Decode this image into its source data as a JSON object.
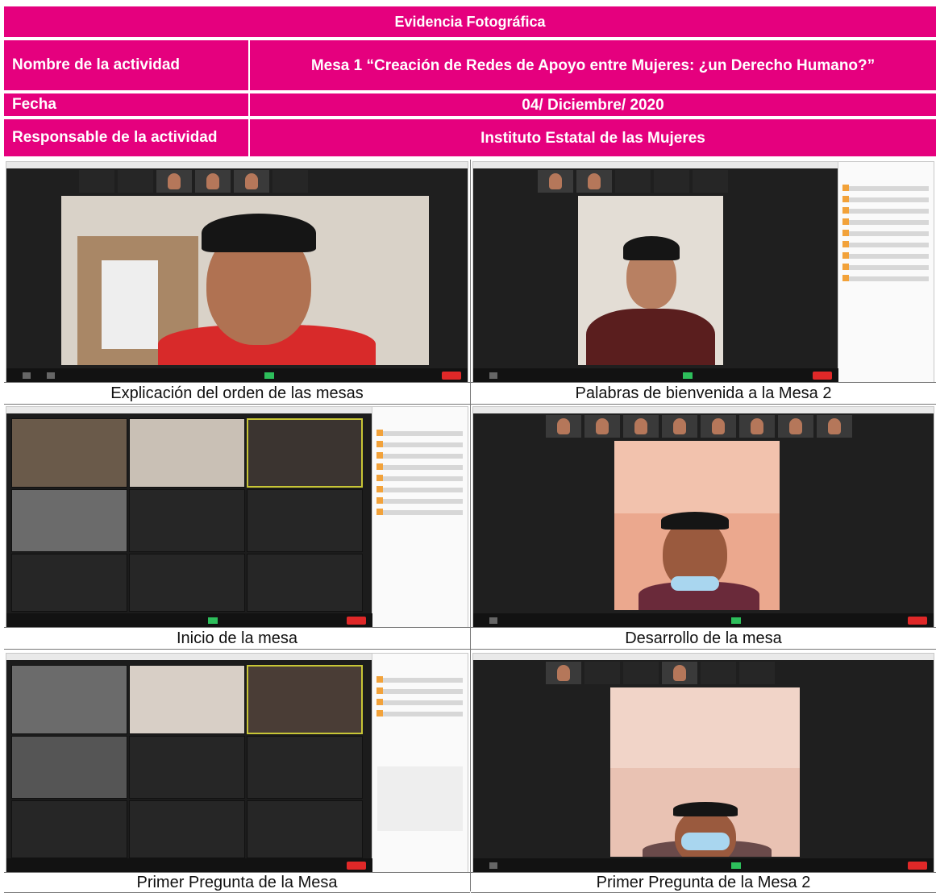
{
  "header": {
    "title": "Evidencia Fotográfica",
    "rows": [
      {
        "label": "Nombre de la actividad",
        "value": "Mesa 1 “Creación de Redes de Apoyo entre Mujeres: ¿un Derecho Humano?”"
      },
      {
        "label": "Fecha",
        "value": "04/ Diciembre/ 2020"
      },
      {
        "label": "Responsable de la actividad",
        "value": "Instituto Estatal de las Mujeres"
      }
    ],
    "color": "#e5007e"
  },
  "photos": [
    {
      "caption": "Explicación del orden de las mesas"
    },
    {
      "caption": "Palabras de bienvenida a la Mesa 2"
    },
    {
      "caption": "Inicio de la mesa"
    },
    {
      "caption": "Desarrollo de la mesa"
    },
    {
      "caption": "Primer Pregunta de la Mesa"
    },
    {
      "caption": "Primer Pregunta de la Mesa 2"
    }
  ]
}
